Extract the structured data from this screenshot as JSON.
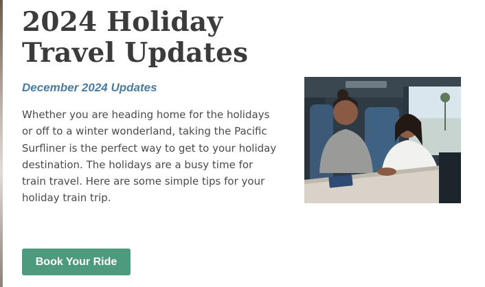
{
  "article": {
    "title": "2024 Holiday Travel Updates",
    "subtitle": "December 2024 Updates",
    "body": "Whether you are heading home for the holidays or off to a winter wonderland, taking the Pacific Surfliner is the perfect way to get to your holiday destination. The holidays are a busy time for train travel. Here are some simple tips for your holiday train trip.",
    "cta_label": "Book Your Ride"
  },
  "colors": {
    "title": "#3b3b3b",
    "subtitle": "#4a7ba3",
    "body": "#4a4a4a",
    "button_bg": "#4e9a7f",
    "button_text": "#ffffff"
  },
  "image": {
    "subject": "two-travelers-on-train-photo"
  }
}
